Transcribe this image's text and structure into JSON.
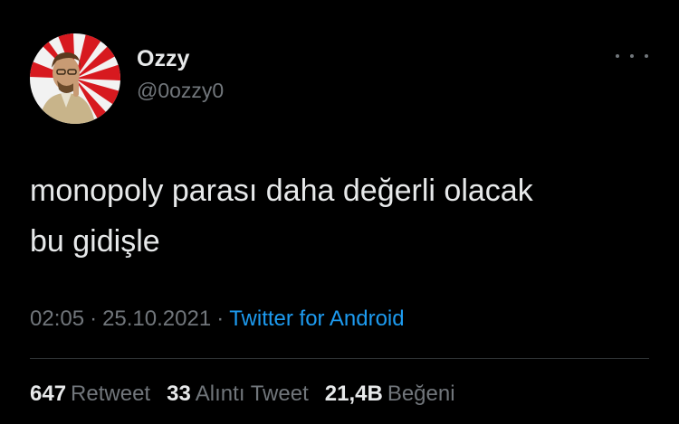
{
  "tweet": {
    "display_name": "Ozzy",
    "handle": "@0ozzy0",
    "text": "monopoly parası daha değerli olacak\nbu gidişle",
    "time": "02:05",
    "separator": "·",
    "date": "25.10.2021",
    "source": "Twitter for Android",
    "more_icon": "ellipsis-icon",
    "avatar_icon": "profile-photo"
  },
  "stats": {
    "retweets": {
      "count": "647",
      "label": "Retweet"
    },
    "quotes": {
      "count": "33",
      "label": "Alıntı Tweet"
    },
    "likes": {
      "count": "21,4B",
      "label": "Beğeni"
    }
  },
  "colors": {
    "background": "#000000",
    "text": "#e7e9ea",
    "secondary": "#71767b",
    "link": "#1d9bf0",
    "divider": "#2f3336",
    "avatar_red": "#d7191f"
  }
}
